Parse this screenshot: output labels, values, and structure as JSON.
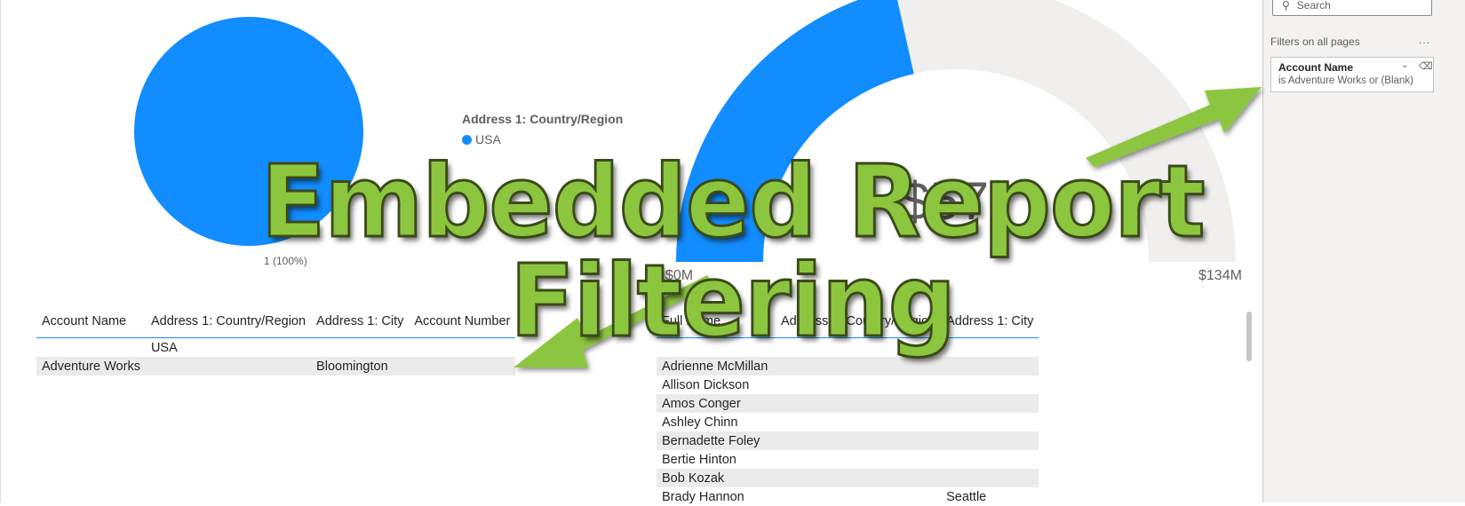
{
  "pie": {
    "label": "1 (100%)",
    "color": "#118dff"
  },
  "legend": {
    "title": "Address 1: Country/Region",
    "items": [
      {
        "label": "USA",
        "color": "#118dff"
      }
    ]
  },
  "gauge": {
    "value_text": "$57",
    "min_label": "$0M",
    "max_label": "$134M",
    "fill_fraction": 0.43,
    "fill_color": "#118dff",
    "track_color": "#f0efee"
  },
  "table_accounts": {
    "columns": [
      "Account Name",
      "Address 1: Country/Region",
      "Address 1: City",
      "Account Number"
    ],
    "rows": [
      [
        "",
        "USA",
        "",
        ""
      ],
      [
        "Adventure Works",
        "",
        "Bloomington",
        ""
      ]
    ]
  },
  "table_contacts": {
    "columns": [
      "Full Name",
      "Address 1: Country/Region",
      "Address 1: City"
    ],
    "rows": [
      [
        "Adrienne McMillan",
        "",
        ""
      ],
      [
        "Allison Dickson",
        "",
        ""
      ],
      [
        "Amos Conger",
        "",
        ""
      ],
      [
        "Ashley Chinn",
        "",
        ""
      ],
      [
        "Bernadette Foley",
        "",
        ""
      ],
      [
        "Bertie Hinton",
        "",
        ""
      ],
      [
        "Bob Kozak",
        "",
        ""
      ],
      [
        "Brady Hannon",
        "",
        "Seattle"
      ]
    ]
  },
  "filter_pane": {
    "search_placeholder": "Search",
    "section_label": "Filters on all pages",
    "more_label": "...",
    "filter": {
      "title": "Account Name",
      "description": "is Adventure Works or (Blank)"
    }
  },
  "overlay": {
    "title": "Embedded Report Filtering",
    "color": "#8cc63f"
  }
}
